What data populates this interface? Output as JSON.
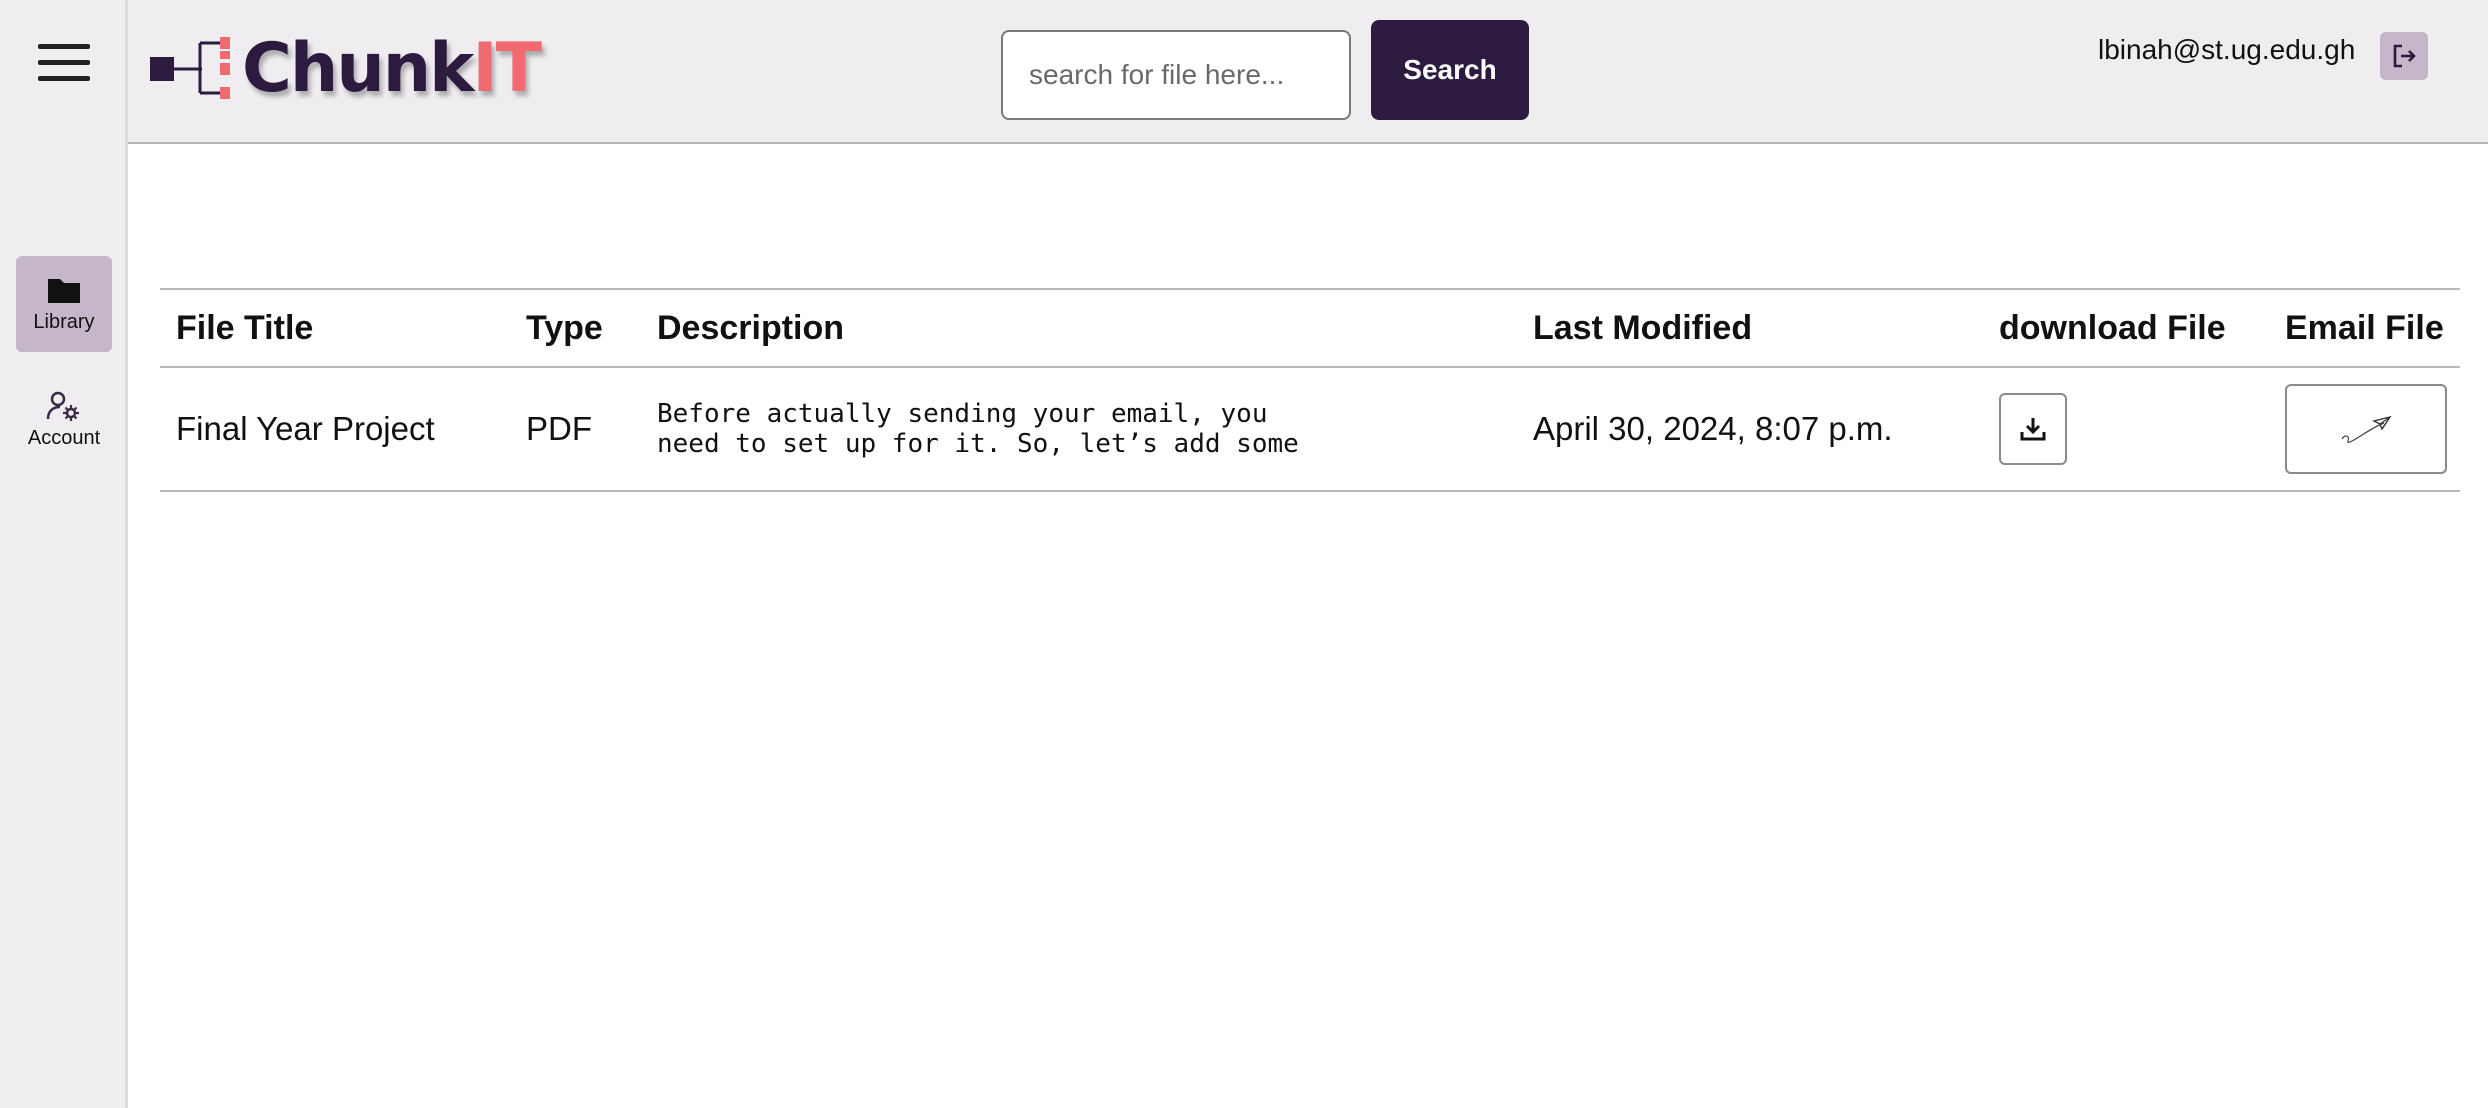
{
  "app": {
    "logo_part1": "Chunk",
    "logo_part2": "IT"
  },
  "header": {
    "search_placeholder": "search for file here...",
    "search_button": "Search",
    "user_email": "lbinah@st.ug.edu.gh"
  },
  "sidebar": {
    "items": [
      {
        "label": "Library",
        "icon": "folder-icon",
        "active": true
      },
      {
        "label": "Account",
        "icon": "user-settings-icon",
        "active": false
      }
    ]
  },
  "table": {
    "columns": [
      "File Title",
      "Type",
      "Description",
      "Last Modified",
      "download File",
      "Email File"
    ],
    "rows": [
      {
        "title": "Final Year Project",
        "type": "PDF",
        "description": "Before actually sending your email, you\nneed to set up for it. So, let’s add some",
        "last_modified": "April 30, 2024, 8:07 p.m."
      }
    ]
  },
  "colors": {
    "primary": "#2d1b3f",
    "accent": "#f06a6f",
    "nav_active": "#c6b6c9",
    "chrome_bg": "#efedf0"
  }
}
